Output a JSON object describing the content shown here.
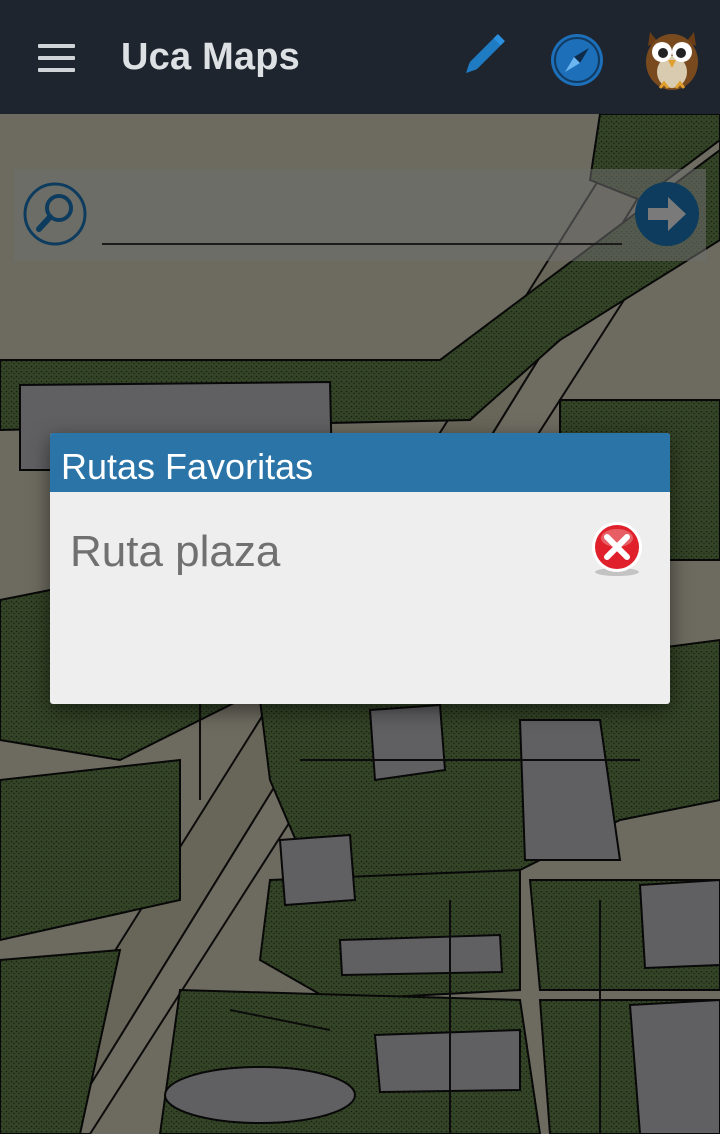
{
  "appbar": {
    "title": "Uca Maps",
    "menu_icon": "hamburger-menu-icon",
    "edit_icon": "pencil-icon",
    "compass_icon": "compass-icon",
    "profile_icon": "owl-avatar-icon"
  },
  "search": {
    "value": "",
    "search_icon": "magnifier-icon",
    "go_icon": "arrow-right-icon"
  },
  "dialog": {
    "title": "Rutas Favoritas",
    "items": [
      {
        "label": "Ruta plaza",
        "delete_icon": "red-x-icon"
      }
    ]
  },
  "colors": {
    "appbar": "#1e252f",
    "dialog_header": "#2a74a8",
    "accent_blue": "#1c7ec4",
    "delete_red": "#e0202a",
    "map_green": "#6c8c52",
    "map_bg": "#e3dfc6",
    "building": "#c9c9cb"
  }
}
